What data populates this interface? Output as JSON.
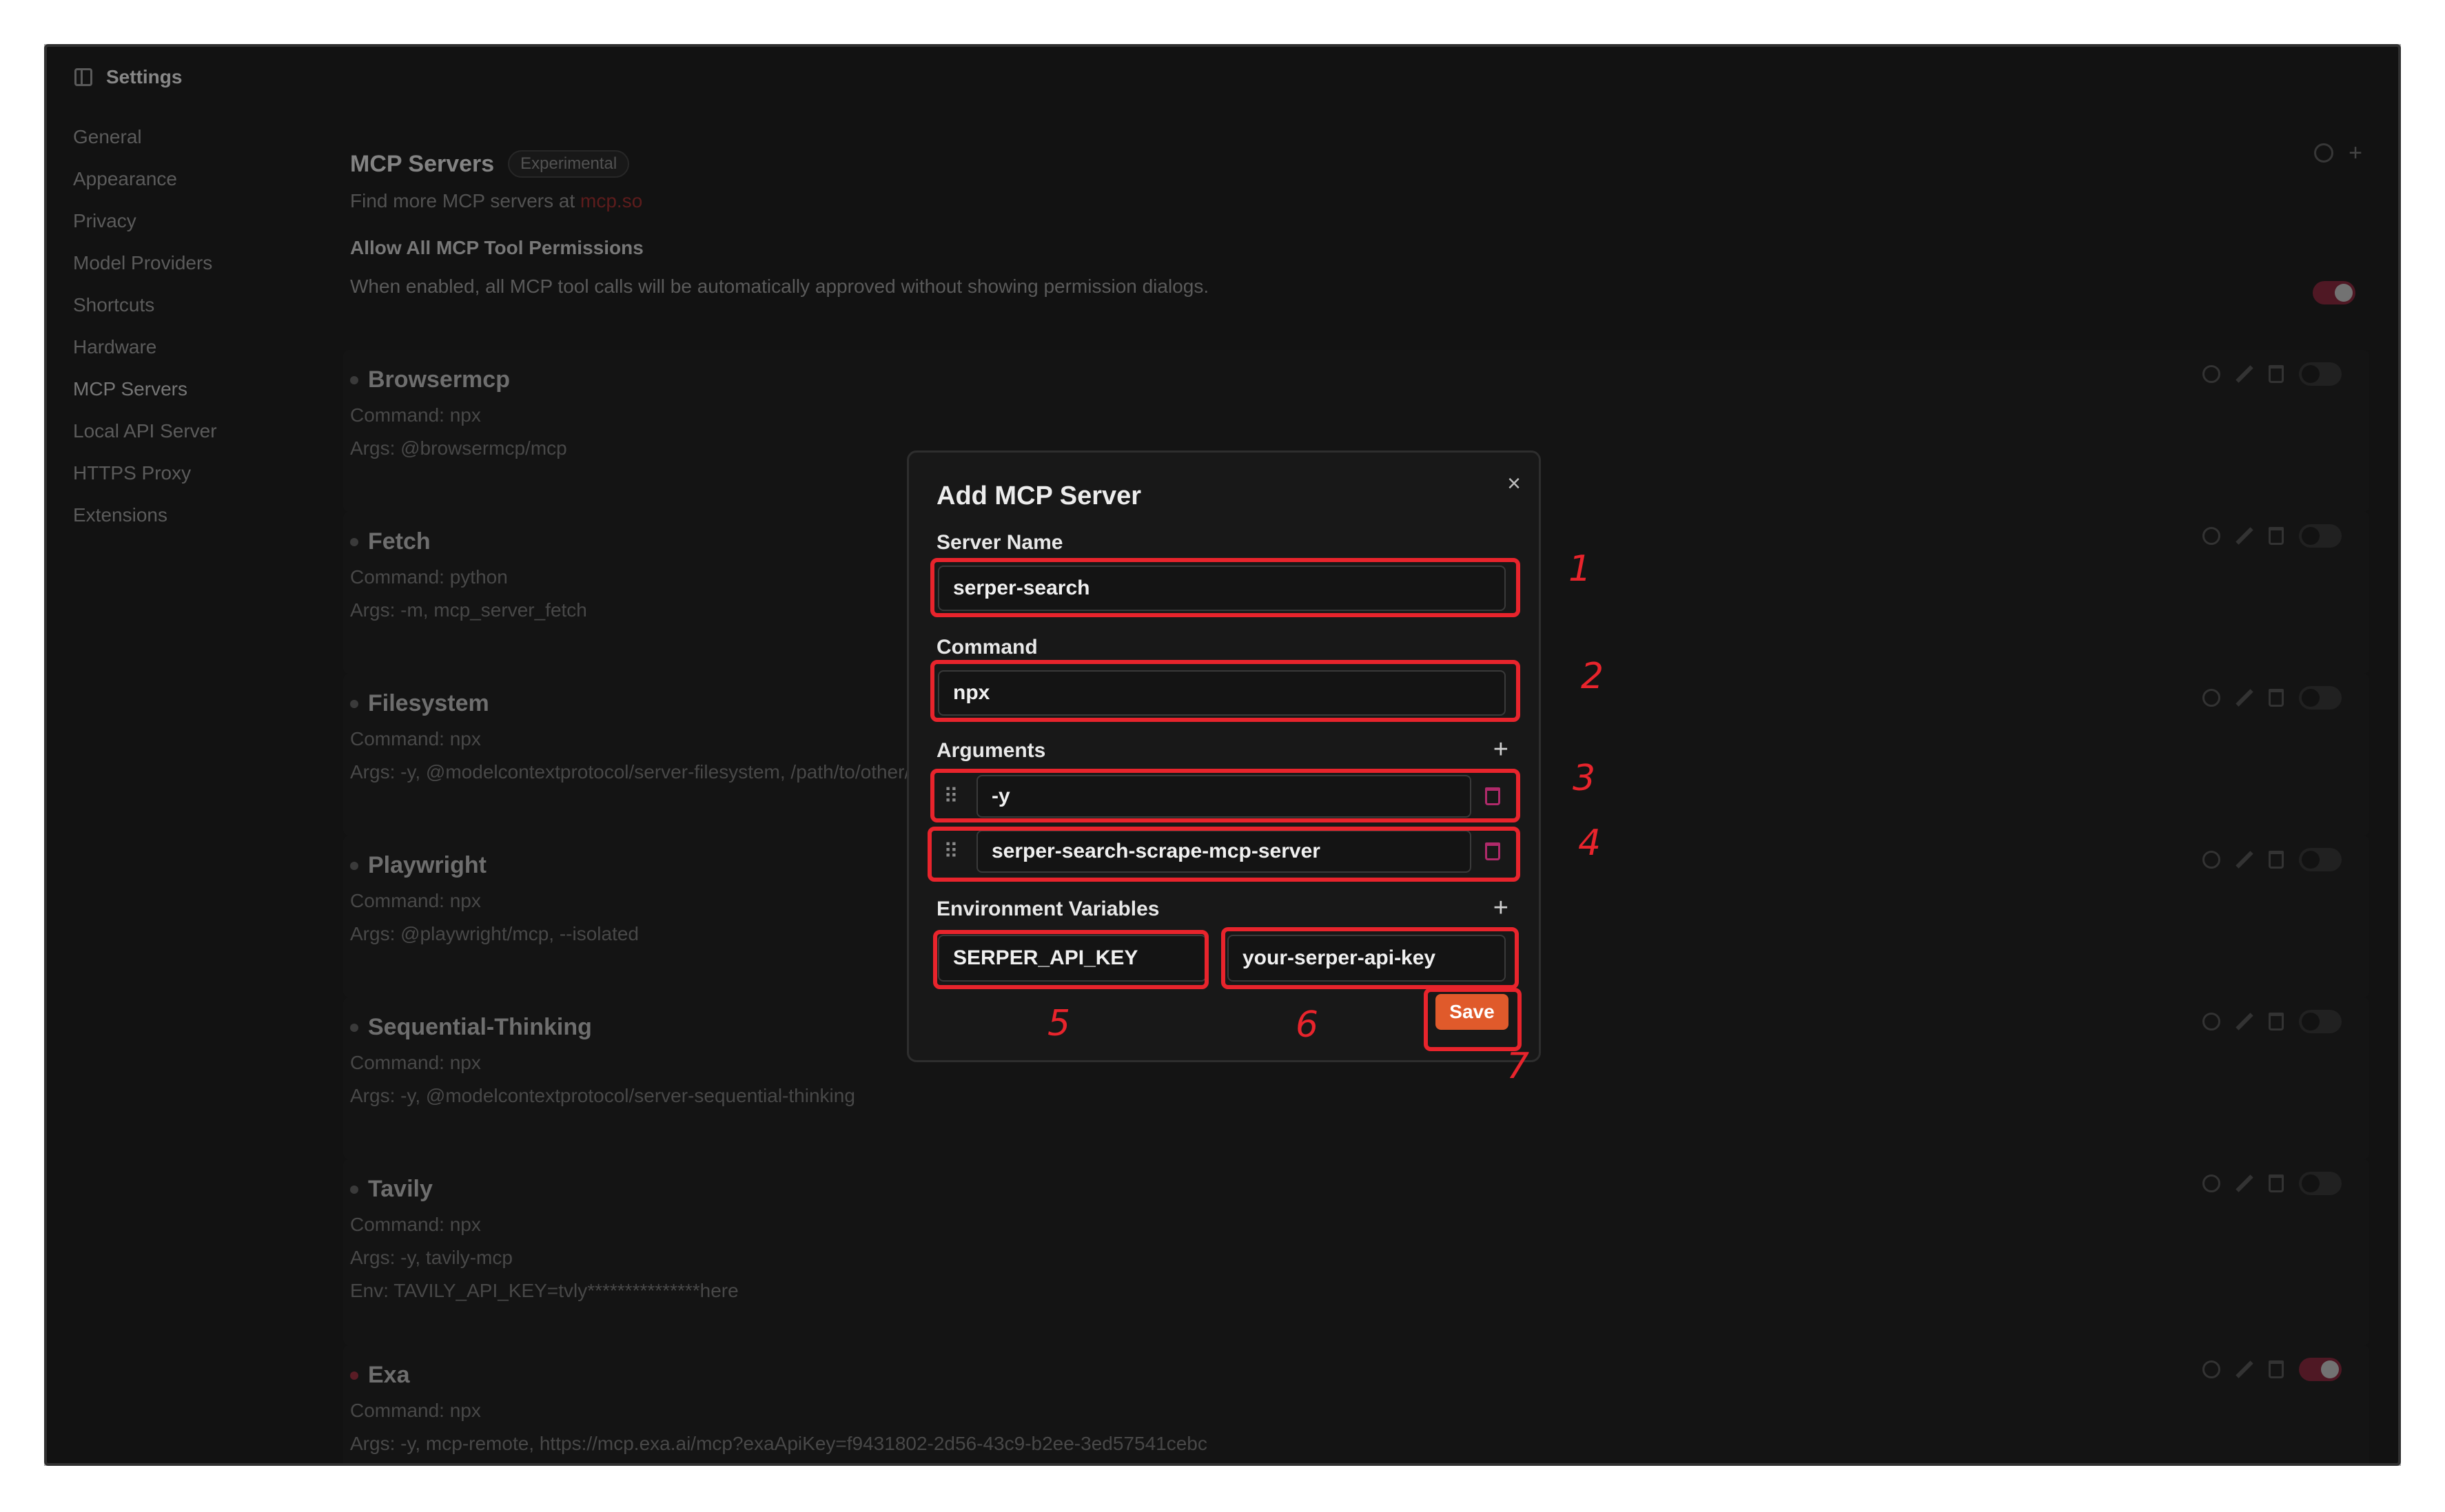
{
  "window": {
    "title": "Settings",
    "panel_icon": "sidebar-toggle-icon"
  },
  "sidebar": {
    "items": [
      {
        "label": "General"
      },
      {
        "label": "Appearance"
      },
      {
        "label": "Privacy"
      },
      {
        "label": "Model Providers"
      },
      {
        "label": "Shortcuts"
      },
      {
        "label": "Hardware"
      },
      {
        "label": "MCP Servers",
        "active": true
      },
      {
        "label": "Local API Server"
      },
      {
        "label": "HTTPS Proxy"
      },
      {
        "label": "Extensions"
      }
    ]
  },
  "header": {
    "title": "MCP Servers",
    "badge": "Experimental",
    "find_prefix": "Find more MCP servers at ",
    "find_link": "mcp.so",
    "permissions_title": "Allow All MCP Tool Permissions",
    "permissions_desc": "When enabled, all MCP tool calls will be automatically approved without showing permission dialogs.",
    "permissions_enabled": true
  },
  "servers": [
    {
      "name": "Browsermcp",
      "command": "Command: npx",
      "args": "Args: @browsermcp/mcp",
      "enabled": false
    },
    {
      "name": "Fetch",
      "command": "Command: python",
      "args": "Args: -m, mcp_server_fetch",
      "enabled": false
    },
    {
      "name": "Filesystem",
      "command": "Command: npx",
      "args": "Args: -y, @modelcontextprotocol/server-filesystem, /path/to/other/allowed/dir",
      "enabled": false
    },
    {
      "name": "Playwright",
      "command": "Command: npx",
      "args": "Args: @playwright/mcp, --isolated",
      "enabled": false
    },
    {
      "name": "Sequential-Thinking",
      "command": "Command: npx",
      "args": "Args: -y, @modelcontextprotocol/server-sequential-thinking",
      "enabled": false
    },
    {
      "name": "Tavily",
      "command": "Command: npx",
      "args": "Args: -y, tavily-mcp",
      "env": "Env: TAVILY_API_KEY=tvly***************here",
      "enabled": false
    },
    {
      "name": "Exa",
      "command": "Command: npx",
      "args": "Args: -y, mcp-remote, https://mcp.exa.ai/mcp?exaApiKey=f9431802-2d56-43c9-b2ee-3ed57541cebc",
      "enabled": true
    }
  ],
  "modal": {
    "title": "Add MCP Server",
    "close_label": "×",
    "server_name_label": "Server Name",
    "server_name_value": "serper-search",
    "command_label": "Command",
    "command_value": "npx",
    "arguments_label": "Arguments",
    "arguments": [
      "-y",
      "serper-search-scrape-mcp-server"
    ],
    "env_label": "Environment Variables",
    "env_key": "SERPER_API_KEY",
    "env_value": "your-serper-api-key",
    "save_label": "Save",
    "add_glyph": "+",
    "grip_glyph": "⠿"
  },
  "annotations": [
    "1",
    "2",
    "3",
    "4",
    "5",
    "6",
    "7"
  ],
  "colors": {
    "annotation": "#e8242c",
    "save_button": "#e05a2b",
    "toggle_on": "#7a2538",
    "delete_icon": "#b02a6a"
  }
}
